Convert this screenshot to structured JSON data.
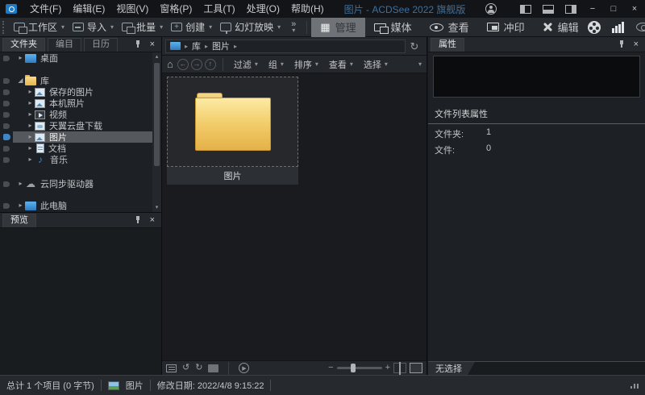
{
  "icons": {
    "dropdown": "▾",
    "overflow": "»",
    "expander_collapsed": "▸",
    "expander_expanded": "◢",
    "breadcrumb_sep": "▸",
    "refresh": "↻",
    "home": "⌂",
    "back": "←",
    "forward": "→",
    "up": "↑",
    "rotate_left": "↺",
    "rotate_right": "↻",
    "play": "▶",
    "minus": "−",
    "plus": "+",
    "minimize": "−",
    "maximize": "□",
    "close": "×",
    "panel_close": "×",
    "scroll_up": "▴",
    "scroll_down": "▾",
    "grid": "▦",
    "music": "♪",
    "cloud": "☁"
  },
  "titlebar": {
    "title": "图片 - ACDSee 2022 旗舰版",
    "menus": [
      "文件(F)",
      "编辑(E)",
      "视图(V)",
      "窗格(P)",
      "工具(T)",
      "处理(O)",
      "帮助(H)"
    ]
  },
  "toolbar": {
    "buttons": [
      {
        "label": "工作区"
      },
      {
        "label": "导入"
      },
      {
        "label": "批量"
      },
      {
        "label": "创建"
      },
      {
        "label": "幻灯放映"
      }
    ],
    "modes": [
      {
        "label": "管理",
        "active": true
      },
      {
        "label": "媒体",
        "active": false
      },
      {
        "label": "查看",
        "active": false
      },
      {
        "label": "冲印",
        "active": false
      },
      {
        "label": "编辑",
        "active": false
      }
    ]
  },
  "left_panel": {
    "tabs": [
      {
        "label": "文件夹",
        "active": true
      },
      {
        "label": "编目",
        "active": false
      },
      {
        "label": "日历",
        "active": false
      }
    ],
    "tree": [
      {
        "label": "桌面"
      },
      {
        "label": "库",
        "expanded": true
      },
      {
        "label": "保存的图片"
      },
      {
        "label": "本机照片"
      },
      {
        "label": "视频"
      },
      {
        "label": "天翼云盘下载"
      },
      {
        "label": "图片",
        "selected": true
      },
      {
        "label": "文档"
      },
      {
        "label": "音乐"
      },
      {
        "label": "云同步驱动器"
      },
      {
        "label": "此电脑"
      }
    ],
    "preview_title": "预览"
  },
  "content": {
    "breadcrumb": {
      "items": [
        "库",
        "图片"
      ]
    },
    "nav_menus": [
      "过滤",
      "组",
      "排序",
      "查看",
      "选择"
    ],
    "tiles": [
      {
        "label": "图片",
        "type": "folder"
      }
    ]
  },
  "right_panel": {
    "title": "属性",
    "section_title": "文件列表属性",
    "rows": [
      {
        "label": "文件夹:",
        "value": "1"
      },
      {
        "label": "文件:",
        "value": "0"
      }
    ],
    "bottom_tab": "无选择"
  },
  "statusbar": {
    "total": "总计 1 个项目 (0 字节)",
    "location": "图片",
    "modified": "修改日期: 2022/4/8 9:15:22"
  },
  "colors": {
    "accent_blue": "#2f7cc0",
    "title_text": "#41709b",
    "folder_yellow": "#f3cf6e",
    "selection_gray": "#55585c",
    "panel_bg": "#1d2024",
    "toolbar_bg": "#26292d",
    "titlebar_bg": "#121418"
  }
}
